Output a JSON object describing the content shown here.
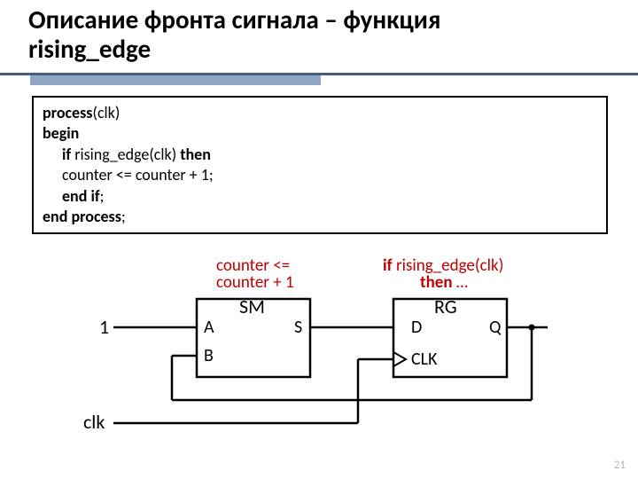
{
  "title_line1": "Описание фронта сигнала – функция",
  "title_line2": "rising_edge",
  "code": {
    "l1a": "process",
    "l1b": "(clk)",
    "l2": "begin",
    "l3a": "if ",
    "l3b": "rising_edge(clk) ",
    "l3c": "then",
    "l4": "counter <= counter + 1;",
    "l5a": "end if",
    "l5b": ";",
    "l6a": "end process",
    "l6b": ";"
  },
  "diagram": {
    "sm_caption_l1": "counter <=",
    "sm_caption_l2": "counter + 1",
    "rg_caption_l1a": "if ",
    "rg_caption_l1b": "rising_edge(clk)",
    "rg_caption_l2a": "then ",
    "rg_caption_l2b": "…",
    "one": "1",
    "clk": "clk",
    "sm_title": "SM",
    "sm_inA": "A",
    "sm_inB": "B",
    "sm_out": "S",
    "rg_title": "RG",
    "rg_inD": "D",
    "rg_inCLK": "CLK",
    "rg_out": "Q"
  },
  "page": "21"
}
